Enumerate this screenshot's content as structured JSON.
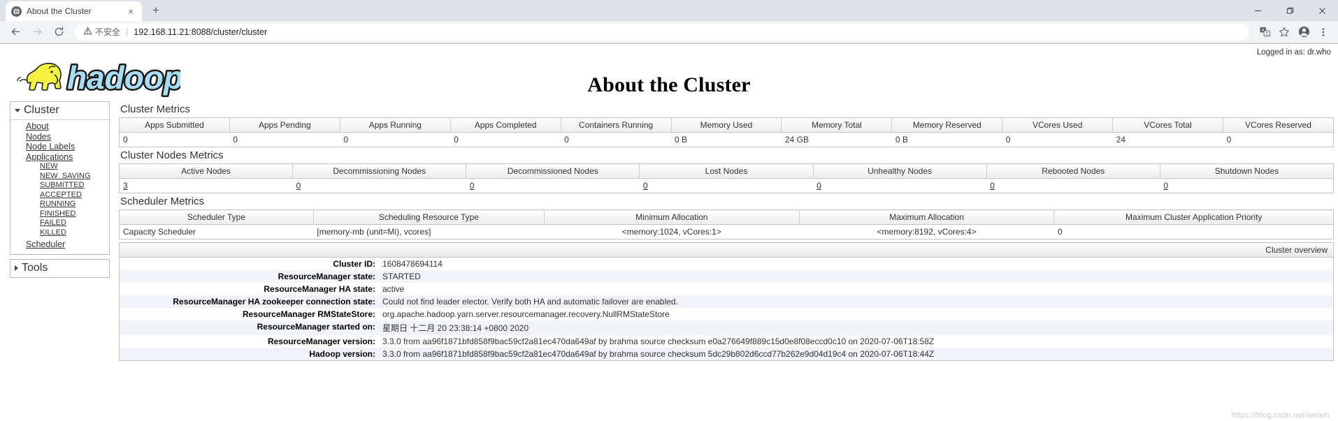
{
  "browser": {
    "tab": {
      "title": "About the Cluster",
      "favicon": "globe-icon",
      "close": "×"
    },
    "new_tab": "+",
    "window": {
      "minimize": "—",
      "maximize": "❐",
      "close": "✕"
    },
    "nav": {
      "back": "←",
      "forward": "→",
      "reload": "⟳"
    },
    "omnibox": {
      "security_label": "不安全",
      "separator": "|",
      "url": "192.168.11.21:8088/cluster/cluster"
    },
    "toolbar_icons": [
      "translate-icon",
      "bookmark-star-icon",
      "profile-icon",
      "menu-kebab-icon"
    ]
  },
  "header": {
    "logged_in": "Logged in as: dr.who",
    "title": "About the Cluster",
    "logo_alt": "hadoop"
  },
  "sidebar": {
    "cluster": {
      "label": "Cluster",
      "items": [
        {
          "label": "About"
        },
        {
          "label": "Nodes"
        },
        {
          "label": "Node Labels"
        },
        {
          "label": "Applications"
        }
      ],
      "app_states": [
        {
          "label": "NEW"
        },
        {
          "label": "NEW_SAVING"
        },
        {
          "label": "SUBMITTED"
        },
        {
          "label": "ACCEPTED"
        },
        {
          "label": "RUNNING"
        },
        {
          "label": "FINISHED"
        },
        {
          "label": "FAILED"
        },
        {
          "label": "KILLED"
        }
      ],
      "scheduler": {
        "label": "Scheduler"
      }
    },
    "tools": {
      "label": "Tools"
    }
  },
  "cluster_metrics": {
    "title": "Cluster Metrics",
    "headers": [
      "Apps Submitted",
      "Apps Pending",
      "Apps Running",
      "Apps Completed",
      "Containers Running",
      "Memory Used",
      "Memory Total",
      "Memory Reserved",
      "VCores Used",
      "VCores Total",
      "VCores Reserved"
    ],
    "values": [
      "0",
      "0",
      "0",
      "0",
      "0",
      "0 B",
      "24 GB",
      "0 B",
      "0",
      "24",
      "0"
    ]
  },
  "cluster_nodes_metrics": {
    "title": "Cluster Nodes Metrics",
    "headers": [
      "Active Nodes",
      "Decommissioning Nodes",
      "Decommissioned Nodes",
      "Lost Nodes",
      "Unhealthy Nodes",
      "Rebooted Nodes",
      "Shutdown Nodes"
    ],
    "values": [
      "3",
      "0",
      "0",
      "0",
      "0",
      "0",
      "0"
    ]
  },
  "scheduler_metrics": {
    "title": "Scheduler Metrics",
    "headers": [
      "Scheduler Type",
      "Scheduling Resource Type",
      "Minimum Allocation",
      "Maximum Allocation",
      "Maximum Cluster Application Priority"
    ],
    "values": [
      "Capacity Scheduler",
      "[memory-mb (unit=Mi), vcores]",
      "<memory:1024, vCores:1>",
      "<memory:8192, vCores:4>",
      "0"
    ]
  },
  "cluster_overview": {
    "panel_label": "Cluster overview",
    "rows": [
      {
        "label": "Cluster ID:",
        "value": "1608478694114"
      },
      {
        "label": "ResourceManager state:",
        "value": "STARTED"
      },
      {
        "label": "ResourceManager HA state:",
        "value": "active"
      },
      {
        "label": "ResourceManager HA zookeeper connection state:",
        "value": "Could not find leader elector. Verify both HA and automatic failover are enabled."
      },
      {
        "label": "ResourceManager RMStateStore:",
        "value": "org.apache.hadoop.yarn.server.resourcemanager.recovery.NullRMStateStore"
      },
      {
        "label": "ResourceManager started on:",
        "value": "星期日 十二月 20 23:38:14 +0800 2020"
      },
      {
        "label": "ResourceManager version:",
        "value": "3.3.0 from aa96f1871bfd858f9bac59cf2a81ec470da649af by brahma source checksum e0a276649f889c15d0e8f08eccd0c10 on 2020-07-06T18:58Z"
      },
      {
        "label": "Hadoop version:",
        "value": "3.3.0 from aa96f1871bfd858f9bac59cf2a81ec470da649af by brahma source checksum 5dc29b802d6ccd77b262e9d04d19c4 on 2020-07-06T18:44Z"
      }
    ]
  },
  "watermark": "https://blog.csdn.net/weixin"
}
